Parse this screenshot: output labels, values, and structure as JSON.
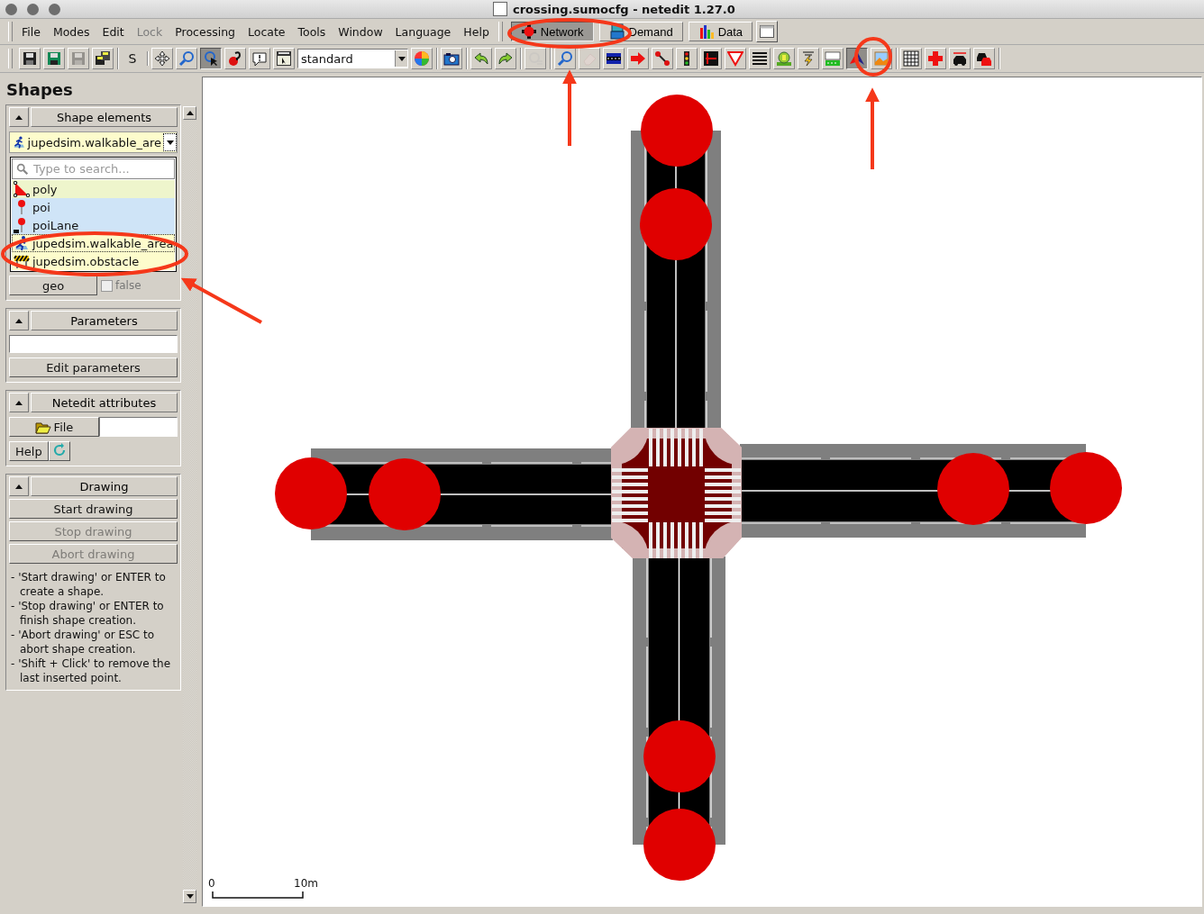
{
  "window": {
    "title": "crossing.sumocfg - netedit 1.27.0"
  },
  "menu": [
    {
      "label": "File",
      "disabled": false
    },
    {
      "label": "Modes",
      "disabled": false
    },
    {
      "label": "Edit",
      "disabled": false
    },
    {
      "label": "Lock",
      "disabled": true
    },
    {
      "label": "Processing",
      "disabled": false
    },
    {
      "label": "Locate",
      "disabled": false
    },
    {
      "label": "Tools",
      "disabled": false
    },
    {
      "label": "Window",
      "disabled": false
    },
    {
      "label": "Language",
      "disabled": false
    },
    {
      "label": "Help",
      "disabled": false
    }
  ],
  "modes": [
    {
      "label": "Network",
      "kind": "network",
      "selected": true
    },
    {
      "label": "Demand",
      "kind": "demand",
      "selected": false
    },
    {
      "label": "Data",
      "kind": "data",
      "selected": false
    }
  ],
  "toolbar_groups": [
    [
      {
        "kind": "save",
        "selected": false,
        "disabled": false
      },
      {
        "kind": "save-as",
        "selected": false,
        "disabled": false
      },
      {
        "kind": "save",
        "selected": false,
        "disabled": true
      },
      {
        "kind": "save-multiple",
        "selected": false,
        "disabled": false
      }
    ],
    [
      {
        "kind": "text",
        "label": "S"
      }
    ],
    [
      {
        "kind": "move",
        "selected": false,
        "disabled": false
      },
      {
        "kind": "zoom",
        "selected": false,
        "disabled": false
      },
      {
        "kind": "locate",
        "selected": true,
        "disabled": false
      },
      {
        "kind": "help",
        "selected": false,
        "disabled": false
      },
      {
        "kind": "comment",
        "selected": false,
        "disabled": false
      },
      {
        "kind": "menu",
        "selected": false,
        "disabled": false
      },
      {
        "kind": "combo",
        "value": "standard"
      },
      {
        "kind": "color-wheel",
        "selected": false,
        "disabled": false
      }
    ],
    [
      {
        "kind": "camera",
        "selected": false,
        "disabled": false
      }
    ],
    [
      {
        "kind": "undo",
        "selected": false,
        "disabled": false
      },
      {
        "kind": "redo",
        "selected": false,
        "disabled": false
      }
    ],
    [
      {
        "kind": "settings",
        "selected": false,
        "disabled": true
      }
    ],
    [
      {
        "kind": "zoom",
        "selected": false,
        "disabled": false
      },
      {
        "kind": "eraser",
        "selected": false,
        "disabled": true
      },
      {
        "kind": "lanes",
        "selected": false,
        "disabled": false
      },
      {
        "kind": "arrow",
        "selected": false,
        "disabled": false
      },
      {
        "kind": "connection",
        "selected": false,
        "disabled": false
      },
      {
        "kind": "traffic-light",
        "selected": false,
        "disabled": false
      },
      {
        "kind": "crossing",
        "selected": false,
        "disabled": false
      },
      {
        "kind": "yield",
        "selected": false,
        "disabled": false
      },
      {
        "kind": "stripes",
        "selected": false,
        "disabled": false
      },
      {
        "kind": "stop",
        "selected": false,
        "disabled": false
      },
      {
        "kind": "lightning",
        "selected": false,
        "disabled": false
      },
      {
        "kind": "taz",
        "selected": false,
        "disabled": false
      },
      {
        "kind": "shape",
        "selected": true,
        "disabled": false
      },
      {
        "kind": "picture-frame",
        "selected": false,
        "disabled": false
      }
    ],
    [
      {
        "kind": "grid",
        "selected": false,
        "disabled": false
      },
      {
        "kind": "junction",
        "selected": false,
        "disabled": false
      },
      {
        "kind": "car-arrows",
        "selected": false,
        "disabled": false
      },
      {
        "kind": "cars",
        "selected": false,
        "disabled": false
      }
    ]
  ],
  "sidebar": {
    "title": "Shapes",
    "shape_elements": {
      "header": "Shape elements",
      "value": "jupedsim.walkable_are",
      "search_placeholder": "Type to search...",
      "options": [
        {
          "label": "poly",
          "kind": "poly",
          "color": "#eef5cc",
          "selected": false
        },
        {
          "label": "poi",
          "kind": "poi",
          "color": "#cfe4f7",
          "selected": false
        },
        {
          "label": "poiLane",
          "kind": "poilane",
          "color": "#cfe4f7",
          "selected": false
        },
        {
          "label": "jupedsim.walkable_area",
          "kind": "walkable",
          "color": "#fdfccc",
          "selected": true
        },
        {
          "label": "jupedsim.obstacle",
          "kind": "obstacle",
          "color": "#fdfccc",
          "selected": false
        }
      ],
      "geo_button": "geo",
      "geo_checkbox": {
        "label": "false",
        "checked": false
      }
    },
    "parameters": {
      "header": "Parameters",
      "button": "Edit parameters"
    },
    "netedit_attributes": {
      "header": "Netedit attributes",
      "file_button": "File",
      "help_button": "Help"
    },
    "drawing": {
      "header": "Drawing",
      "buttons": [
        {
          "label": "Start drawing",
          "disabled": false
        },
        {
          "label": "Stop drawing",
          "disabled": true
        },
        {
          "label": "Abort drawing",
          "disabled": true
        }
      ],
      "help": [
        {
          "first": "- 'Start drawing' or ENTER to",
          "rest": "create a shape."
        },
        {
          "first": "- 'Stop drawing' or ENTER to",
          "rest": "finish shape creation."
        },
        {
          "first": "- 'Abort drawing' or ESC to",
          "rest": "abort shape creation."
        },
        {
          "first": "- 'Shift + Click' to remove the",
          "rest": "last inserted point."
        }
      ]
    }
  },
  "canvas": {
    "scale": {
      "start": "0",
      "end": "10m"
    }
  }
}
